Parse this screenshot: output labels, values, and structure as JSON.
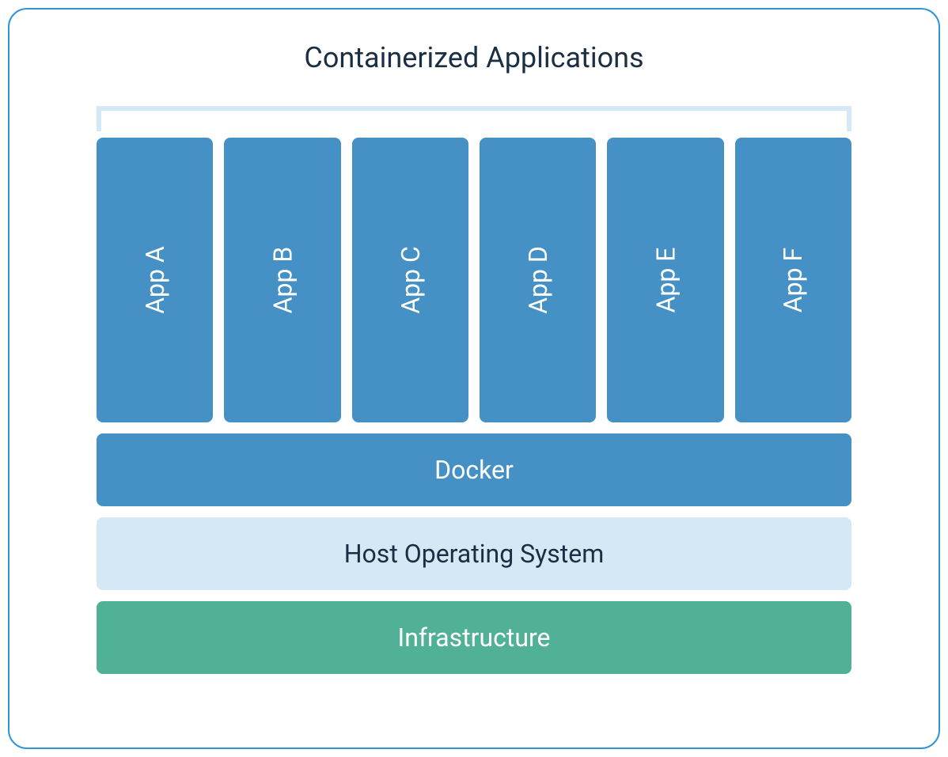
{
  "title": "Containerized Applications",
  "apps": [
    {
      "label": "App A"
    },
    {
      "label": "App B"
    },
    {
      "label": "App C"
    },
    {
      "label": "App D"
    },
    {
      "label": "App E"
    },
    {
      "label": "App F"
    }
  ],
  "layers": {
    "docker": "Docker",
    "host": "Host Operating System",
    "infrastructure": "Infrastructure"
  },
  "colors": {
    "border": "#3194d3",
    "app_box": "#4590c4",
    "docker": "#4590c4",
    "host": "#d4e8f5",
    "infrastructure": "#51b196",
    "title_text": "#1a2e44",
    "bracket": "#d4e8f5"
  }
}
